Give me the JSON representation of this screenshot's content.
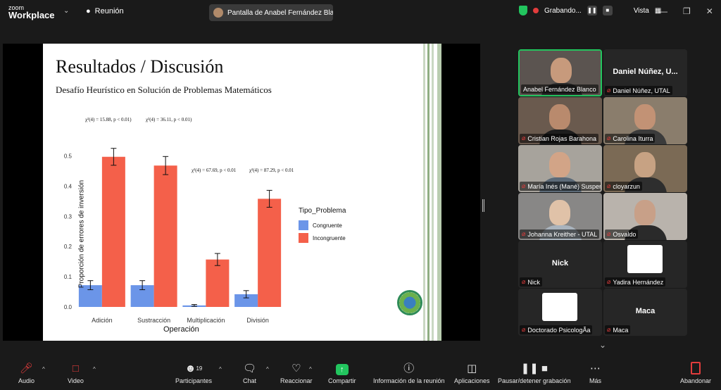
{
  "app": {
    "logo_top": "zoom",
    "logo_bottom": "Workplace",
    "meeting_label": "Reunión",
    "share_pill": "Pantalla de Anabel Fernández Bla",
    "recording_label": "Grabando...",
    "view_label": "Vista"
  },
  "slide": {
    "title": "Resultados / Discusión",
    "subtitle": "Desafío Heurístico en Solución de Problemas Matemáticos",
    "stats": [
      "χ²(4) = 15.88, p < 0.01)",
      "χ²(4) = 36.11, p < 0.01)",
      "χ²(4) = 67.69, p < 0.01",
      "χ²(4) = 87.29, p < 0.01"
    ]
  },
  "chart_data": {
    "type": "bar",
    "categories": [
      "Adición",
      "Sustracción",
      "Multiplicación",
      "División"
    ],
    "series": [
      {
        "name": "Congruente",
        "color": "#6b95e8",
        "values": [
          0.072,
          0.072,
          0.005,
          0.042
        ],
        "err": [
          0.015,
          0.015,
          0.003,
          0.012
        ]
      },
      {
        "name": "Incongruente",
        "color": "#f4604a",
        "values": [
          0.497,
          0.468,
          0.157,
          0.358
        ],
        "err": [
          0.028,
          0.03,
          0.02,
          0.028
        ]
      }
    ],
    "yticks": [
      "0.0",
      "0.1",
      "0.2",
      "0.3",
      "0.4",
      "0.5"
    ],
    "ylim": [
      0,
      0.55
    ],
    "xlabel": "Operación",
    "ylabel": "Proporción de errores de inversión",
    "legend_title": "Tipo_Problema",
    "legend_position": "right"
  },
  "participants": [
    {
      "name": "Anabel Fernández Blanco",
      "muted": false,
      "video": true,
      "skin": "#c79a7c",
      "shirt": "#2b2b2b",
      "bg": "#5b5450"
    },
    {
      "name": "Daniel Núñez, UTAL",
      "big": "Daniel Núñez, U...",
      "muted": true,
      "video": false
    },
    {
      "name": "Cristian Rojas Barahona",
      "muted": true,
      "video": true,
      "skin": "#b98a6d",
      "shirt": "#1d1d1d",
      "bg": "#6a5a4e"
    },
    {
      "name": "Carolina Iturra",
      "muted": true,
      "video": true,
      "skin": "#c29275",
      "shirt": "#3b3b3b",
      "bg": "#8a7d6c"
    },
    {
      "name": "María Inés (Mané) Susperreguy",
      "muted": true,
      "video": true,
      "skin": "#d2a487",
      "shirt": "#5c6a78",
      "bg": "#a7a39c"
    },
    {
      "name": "cloyarzun",
      "muted": true,
      "video": true,
      "skin": "#c7a283",
      "shirt": "#2e2e2e",
      "bg": "#7b6a55"
    },
    {
      "name": "Johanna Kreither - UTAL",
      "muted": true,
      "video": true,
      "skin": "#e0c2a8",
      "shirt": "#a9b3bd",
      "bg": "#888786"
    },
    {
      "name": "Osvaldo",
      "muted": true,
      "video": true,
      "skin": "#c8a088",
      "shirt": "#2a2a2a",
      "bg": "#b9b3ac"
    },
    {
      "name": "Nick",
      "big": "Nick",
      "muted": true,
      "video": false
    },
    {
      "name": "Yadira Hernández",
      "muted": true,
      "video": false,
      "thumb": true
    },
    {
      "name": "Doctorado PsicologÃa",
      "muted": true,
      "video": false,
      "thumb": true
    },
    {
      "name": "Maca",
      "big": "Maca",
      "muted": true,
      "video": false
    }
  ],
  "toolbar": {
    "audio": "Audio",
    "video": "Video",
    "participants": "Participantes",
    "participants_count": "19",
    "chat": "Chat",
    "react": "Reaccionar",
    "share": "Compartir",
    "info": "Información de la reunión",
    "apps": "Aplicaciones",
    "pause_rec": "Pausar/detener grabación",
    "more": "Más",
    "leave": "Abandonar"
  }
}
